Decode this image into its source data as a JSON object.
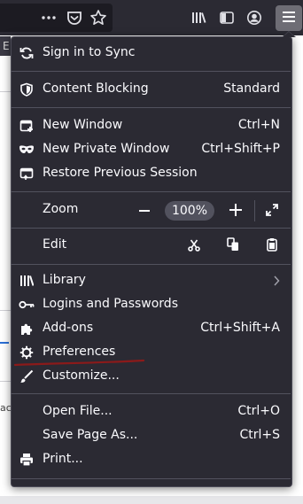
{
  "toolbar": {
    "url_fragment": "",
    "page_actions_icon": "ellipsis-icon",
    "pocket_icon": "pocket-icon",
    "bookmark_icon": "star-icon",
    "library_icon": "library-icon",
    "sidebar_icon": "sidebar-icon",
    "account_icon": "account-icon",
    "menu_icon": "hamburger-icon"
  },
  "background": {
    "tab_fragment": "E",
    "text_fragment": "ac"
  },
  "menu": {
    "sync": {
      "label": "Sign in to Sync",
      "icon": "sync-icon"
    },
    "content_blocking": {
      "label": "Content Blocking",
      "value": "Standard",
      "icon": "shield-icon"
    },
    "new_window": {
      "label": "New Window",
      "shortcut": "Ctrl+N",
      "icon": "new-window-icon"
    },
    "new_private_window": {
      "label": "New Private Window",
      "shortcut": "Ctrl+Shift+P",
      "icon": "private-mask-icon"
    },
    "restore_session": {
      "label": "Restore Previous Session",
      "icon": "restore-icon"
    },
    "zoom": {
      "label": "Zoom",
      "value": "100%"
    },
    "edit": {
      "label": "Edit"
    },
    "library": {
      "label": "Library",
      "icon": "library-icon"
    },
    "logins": {
      "label": "Logins and Passwords",
      "icon": "key-icon"
    },
    "addons": {
      "label": "Add-ons",
      "shortcut": "Ctrl+Shift+A",
      "icon": "puzzle-icon"
    },
    "preferences": {
      "label": "Preferences",
      "icon": "gear-icon"
    },
    "customize": {
      "label": "Customize...",
      "icon": "paintbrush-icon"
    },
    "open_file": {
      "label": "Open File...",
      "shortcut": "Ctrl+O"
    },
    "save_page": {
      "label": "Save Page As...",
      "shortcut": "Ctrl+S"
    },
    "print": {
      "label": "Print...",
      "icon": "printer-icon"
    }
  },
  "colors": {
    "menu_bg": "#2b2a33",
    "text": "#fbfbfe",
    "annotation": "#8b1a1a"
  }
}
